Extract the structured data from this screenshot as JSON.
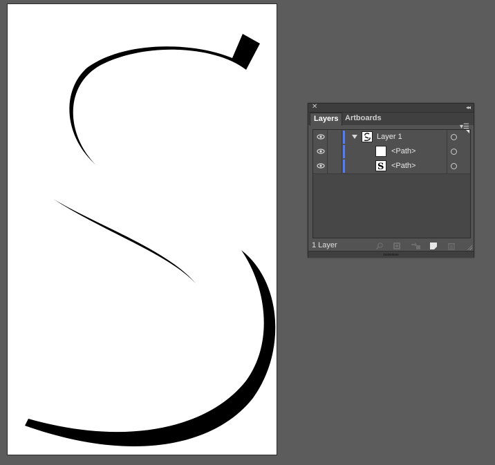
{
  "canvas": {
    "background_color": "#5c5c5c",
    "artboard_color": "#ffffff",
    "artwork": "S-glyph",
    "artwork_color": "#000000"
  },
  "layers_panel": {
    "tabs": [
      {
        "label": "Layers",
        "active": true
      },
      {
        "label": "Artboards",
        "active": false
      }
    ],
    "layer_color": "#4f7cff",
    "rows": [
      {
        "name": "Layer 1",
        "level": "layer",
        "expanded": true,
        "visible": true
      },
      {
        "name": "<Path>",
        "level": "sublayer",
        "visible": true,
        "thumbnail": "blank"
      },
      {
        "name": "<Path>",
        "level": "sublayer",
        "visible": true,
        "thumbnail": "S-glyph"
      }
    ],
    "footer": {
      "count_label": "1 Layer",
      "icons": [
        "locate-object-icon",
        "make-clipping-mask-icon",
        "create-sublayer-icon",
        "new-layer-icon",
        "delete-icon"
      ]
    }
  }
}
